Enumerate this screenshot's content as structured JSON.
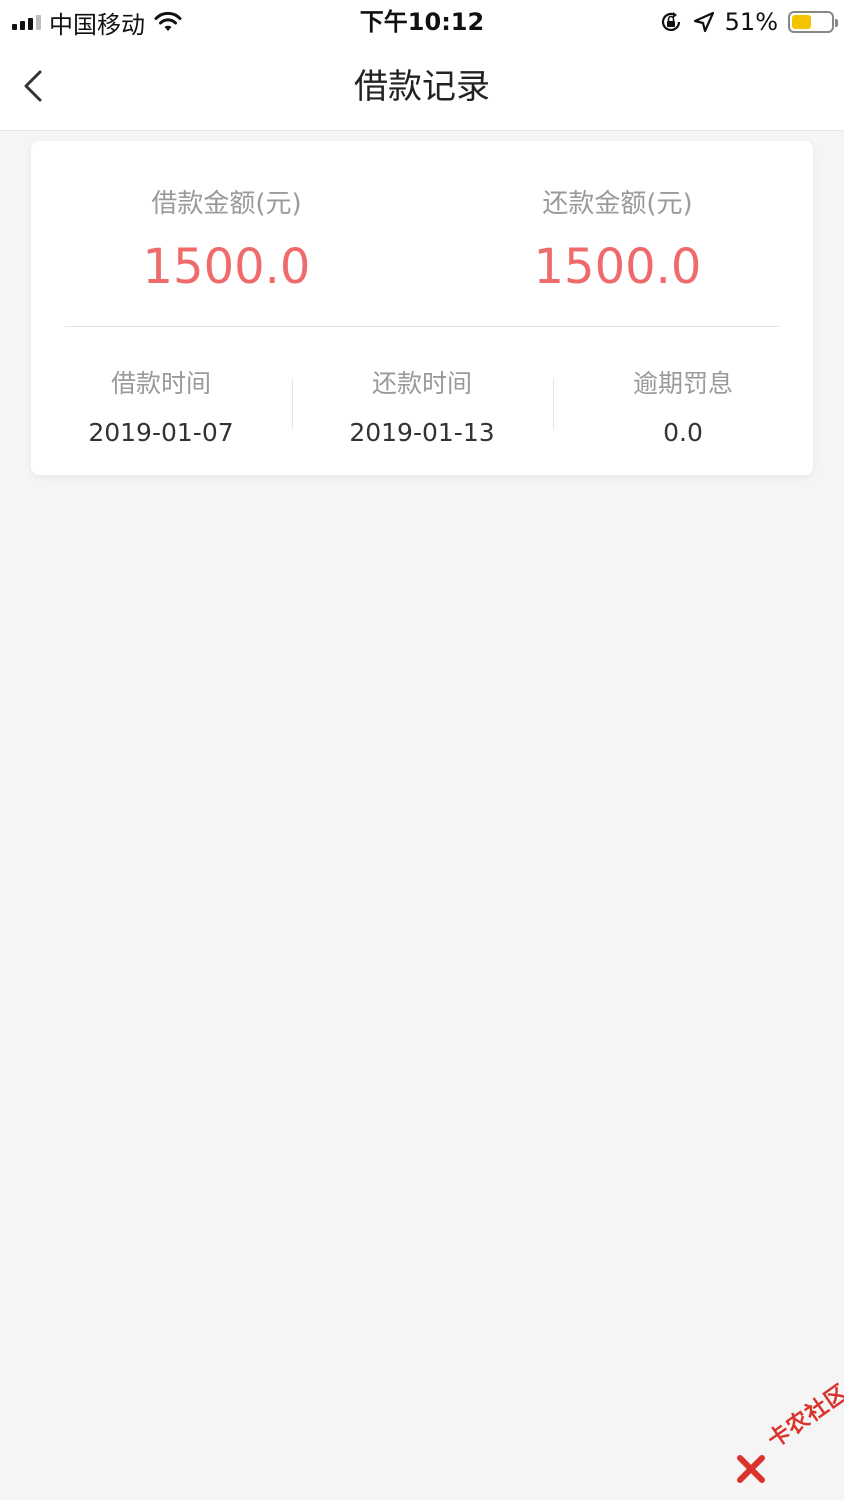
{
  "status_bar": {
    "carrier": "中国移动",
    "time": "下午10:12",
    "battery_percent": "51%",
    "battery_level": 0.51,
    "icons": [
      "signal-icon",
      "wifi-icon",
      "rotation-lock-icon",
      "location-icon",
      "battery-icon"
    ]
  },
  "nav": {
    "title": "借款记录",
    "back_icon": "chevron-left-icon"
  },
  "record": {
    "loan_amount_label": "借款金额(元)",
    "loan_amount": "1500.0",
    "repay_amount_label": "还款金额(元)",
    "repay_amount": "1500.0",
    "loan_time_label": "借款时间",
    "loan_time": "2019-01-07",
    "repay_time_label": "还款时间",
    "repay_time": "2019-01-13",
    "penalty_label": "逾期罚息",
    "penalty": "0.0"
  },
  "watermark": {
    "text": "卡农社区"
  },
  "colors": {
    "accent": "#ef6b6b",
    "background": "#f5f5f5",
    "battery": "#f5c400",
    "watermark": "#d9342c"
  }
}
